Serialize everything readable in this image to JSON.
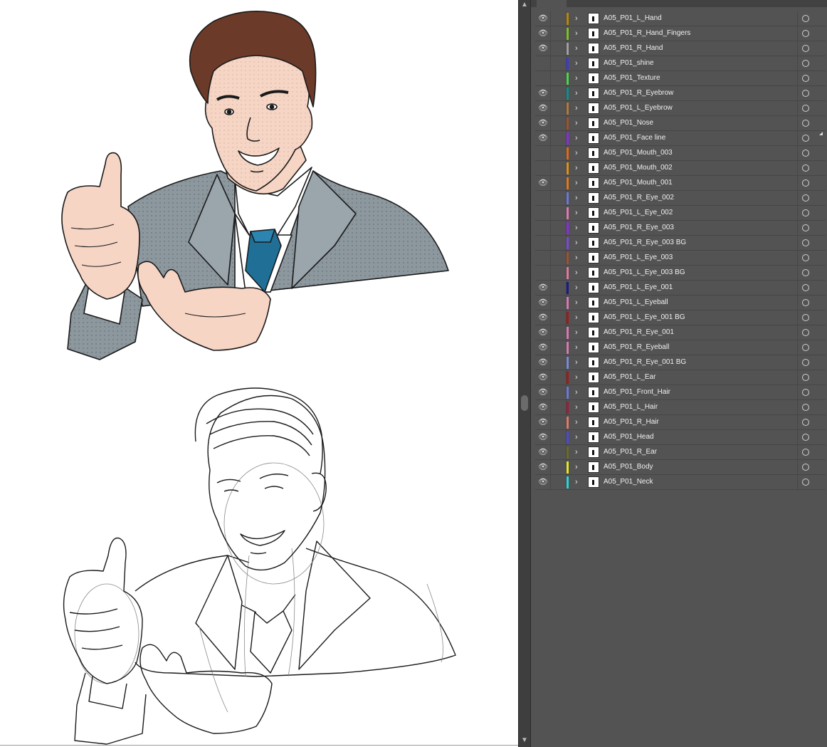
{
  "icons": {
    "visibility": "eye-icon",
    "expand": "chevron-right-icon",
    "target": "target-circle-icon",
    "scroll_up": "chevron-up-icon",
    "scroll_down": "chevron-down-icon"
  },
  "glyphs": {
    "eye": "👁",
    "chevron": "›",
    "scroll_up": "▲",
    "scroll_down": "▼"
  },
  "colors": {
    "panel_bg": "#535353",
    "skin": "#f6d5c5",
    "hair": "#6b3a28",
    "suit": "#8c979e",
    "tie": "#1f6f96"
  },
  "layers": [
    {
      "name": "A05_P01_L_Hand",
      "visible": true,
      "color": "#b8860b"
    },
    {
      "name": "A05_P01_R_Hand_Fingers",
      "visible": true,
      "color": "#7fbf2a"
    },
    {
      "name": "A05_P01_R_Hand",
      "visible": true,
      "color": "#a0a0a0"
    },
    {
      "name": "A05_P01_shine",
      "visible": false,
      "color": "#3a3ad6"
    },
    {
      "name": "A05_P01_Texture",
      "visible": false,
      "color": "#4cd64c"
    },
    {
      "name": "A05_P01_R_Eyebrow",
      "visible": true,
      "color": "#0e8f8f"
    },
    {
      "name": "A05_P01_L_Eyebrow",
      "visible": true,
      "color": "#b07a3a"
    },
    {
      "name": "A05_P01_Nose",
      "visible": true,
      "color": "#a0522d"
    },
    {
      "name": "A05_P01_Face line",
      "visible": true,
      "color": "#8a2be2"
    },
    {
      "name": "A05_P01_Mouth_003",
      "visible": false,
      "color": "#e06a1a"
    },
    {
      "name": "A05_P01_Mouth_002",
      "visible": false,
      "color": "#e0901a"
    },
    {
      "name": "A05_P01_Mouth_001",
      "visible": true,
      "color": "#e07a1a"
    },
    {
      "name": "A05_P01_R_Eye_002",
      "visible": false,
      "color": "#6a7ad6"
    },
    {
      "name": "A05_P01_L_Eye_002",
      "visible": false,
      "color": "#e07ab0"
    },
    {
      "name": "A05_P01_R_Eye_003",
      "visible": false,
      "color": "#8a2be2"
    },
    {
      "name": "A05_P01_R_Eye_003 BG",
      "visible": false,
      "color": "#7a4ad6"
    },
    {
      "name": "A05_P01_L_Eye_003",
      "visible": false,
      "color": "#a0522d"
    },
    {
      "name": "A05_P01_L_Eye_003 BG",
      "visible": false,
      "color": "#e07a9a"
    },
    {
      "name": "A05_P01_L_Eye_001",
      "visible": true,
      "color": "#1a1a8a"
    },
    {
      "name": "A05_P01_L_Eyeball",
      "visible": true,
      "color": "#d67ab0"
    },
    {
      "name": "A05_P01_L_Eye_001 BG",
      "visible": true,
      "color": "#a01a1a"
    },
    {
      "name": "A05_P01_R_Eye_001",
      "visible": true,
      "color": "#d67ab0"
    },
    {
      "name": "A05_P01_R_Eyeball",
      "visible": true,
      "color": "#d67ab0"
    },
    {
      "name": "A05_P01_R_Eye_001 BG",
      "visible": true,
      "color": "#7a8ad6"
    },
    {
      "name": "A05_P01_L_Ear",
      "visible": true,
      "color": "#a01a1a"
    },
    {
      "name": "A05_P01_Front_Hair",
      "visible": true,
      "color": "#6a7ad6"
    },
    {
      "name": "A05_P01_L_Hair",
      "visible": true,
      "color": "#a01a3a"
    },
    {
      "name": "A05_P01_R_Hair",
      "visible": true,
      "color": "#e07a6a"
    },
    {
      "name": "A05_P01_Head",
      "visible": true,
      "color": "#4a4ad6"
    },
    {
      "name": "A05_P01_R_Ear",
      "visible": true,
      "color": "#6a6a2a"
    },
    {
      "name": "A05_P01_Body",
      "visible": true,
      "color": "#e6e62a"
    },
    {
      "name": "A05_P01_Neck",
      "visible": true,
      "color": "#2ad6d6"
    }
  ]
}
